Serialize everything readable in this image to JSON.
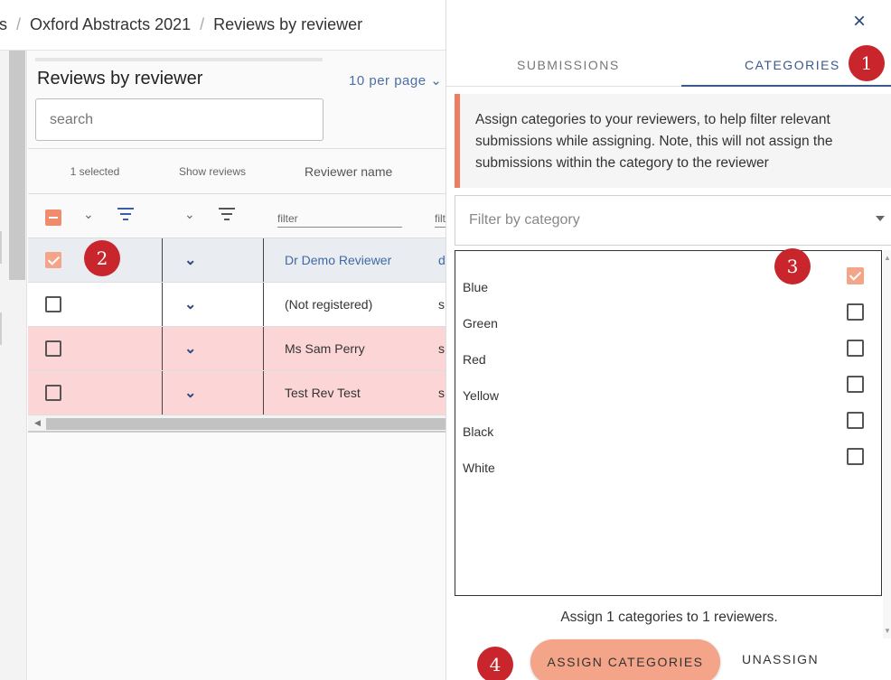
{
  "breadcrumb": {
    "items": [
      "s",
      "Oxford Abstracts 2021",
      "Reviews by reviewer"
    ],
    "separator": "/"
  },
  "main": {
    "title": "Reviews by reviewer",
    "per_page": "10 per page ⌄",
    "search_placeholder": "search",
    "table": {
      "headers": {
        "selected": "1 selected",
        "show_reviews": "Show reviews",
        "reviewer_name": "Reviewer name"
      },
      "filter_placeholder": "filter",
      "filter_placeholder_2": "filt",
      "rows": [
        {
          "name": "Dr Demo Reviewer",
          "email": "d",
          "checked": true,
          "status": "selected"
        },
        {
          "name": "(Not registered)",
          "email": "s",
          "checked": false,
          "status": "normal"
        },
        {
          "name": "Ms Sam Perry",
          "email": "s",
          "checked": false,
          "status": "highlighted"
        },
        {
          "name": "Test Rev Test",
          "email": "s",
          "checked": false,
          "status": "highlighted"
        }
      ]
    }
  },
  "panel": {
    "close_icon": "×",
    "tabs": [
      {
        "label": "SUBMISSIONS",
        "active": false
      },
      {
        "label": "CATEGORIES",
        "active": true
      }
    ],
    "info_text": "Assign categories to your reviewers, to help filter relevant submissions while assigning. Note, this will not assign the submissions within the category to the reviewer",
    "filter_placeholder": "Filter by category",
    "categories": [
      {
        "label": "Blue",
        "checked": true
      },
      {
        "label": "Green",
        "checked": false
      },
      {
        "label": "Red",
        "checked": false
      },
      {
        "label": "Yellow",
        "checked": false
      },
      {
        "label": "Black",
        "checked": false
      },
      {
        "label": "White",
        "checked": false
      }
    ],
    "summary": "Assign 1 categories to 1 reviewers.",
    "assign_button": "ASSIGN CATEGORIES",
    "unassign_button": "UNASSIGN"
  },
  "badges": [
    "1",
    "2",
    "3",
    "4"
  ],
  "colors": {
    "accent": "#f4a488",
    "alert_border": "#ee7d62",
    "badge": "#c8252c",
    "link": "#3e6aa8",
    "highlight_row": "#fcd6d6"
  }
}
